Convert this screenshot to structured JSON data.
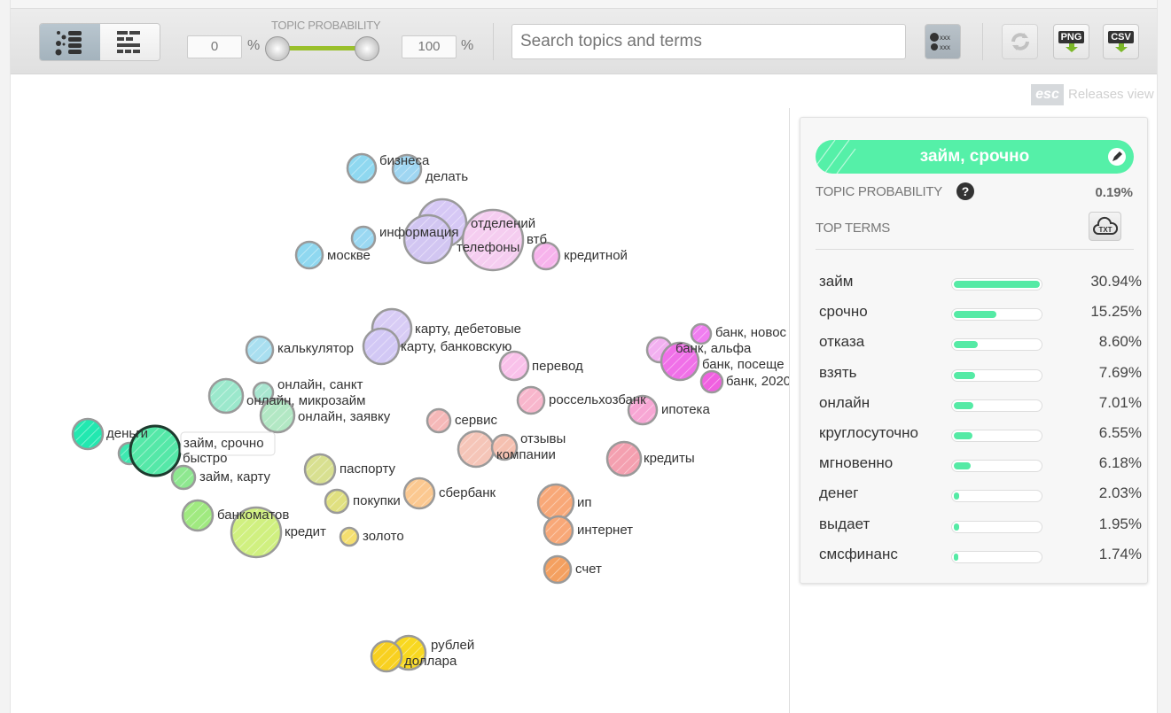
{
  "toolbar": {
    "view_toggle": [
      {
        "name": "bubble-view",
        "active": true
      },
      {
        "name": "list-view",
        "active": false
      }
    ],
    "prob_label": "TOPIC PROBABILITY",
    "min_value": "0",
    "max_value": "100",
    "percent": "%",
    "search_placeholder": "Search topics and terms",
    "buttons": {
      "png": "PNG",
      "csv": "CSV",
      "legend": "xxx"
    },
    "slider_range_percent": [
      0,
      100
    ],
    "slider_color": "#9ac02c"
  },
  "esc": {
    "key": "esc",
    "label": "Releases view"
  },
  "map": {
    "bubbles": [
      {
        "label": "бизнеса",
        "color": "#8fd8f0"
      },
      {
        "label": "делать",
        "color": "#9fd6f2"
      },
      {
        "label": "",
        "color": "#d6c8f5"
      },
      {
        "label": "отделений",
        "color": "#f5cdf0"
      },
      {
        "label": "информация",
        "color": "#d2c6f2"
      },
      {
        "label": "втб",
        "color": ""
      },
      {
        "label": "телефоны",
        "color": ""
      },
      {
        "label": "москве",
        "color": "#8fd8f0"
      },
      {
        "label": "",
        "color": "#9ad8f2"
      },
      {
        "label": "кредитной",
        "color": "#f7b3ec"
      },
      {
        "label": "карту, дебетовые",
        "color": "#d8ccf5"
      },
      {
        "label": "карту, банковскую",
        "color": "#d2c8f5"
      },
      {
        "label": "калькулятор",
        "color": "#a9dff0"
      },
      {
        "label": "перевод",
        "color": "#f9c1ea"
      },
      {
        "label": "россельхозбанк",
        "color": "#f8b6cc"
      },
      {
        "label": "сервис",
        "color": "#f5b8b8"
      },
      {
        "label": "компании",
        "color": "#f5c5b8"
      },
      {
        "label": "отзывы",
        "color": "#f5c0b0"
      },
      {
        "label": "онлайн, санкт",
        "color": "#a8e6d0"
      },
      {
        "label": "",
        "color": "#9be8cc"
      },
      {
        "label": "онлайн, микрозайм",
        "color": ""
      },
      {
        "label": "онлайн, заявку",
        "color": "#b2e8c4"
      },
      {
        "label": "деньги",
        "color": "#22e8b0"
      },
      {
        "label": "",
        "color": "#3ee8b0"
      },
      {
        "label": "займ, срочно",
        "color": "#55e8a8",
        "selected": true
      },
      {
        "label": "быстро",
        "color": ""
      },
      {
        "label": "займ, карту",
        "color": "#8ee890"
      },
      {
        "label": "банкоматов",
        "color": "#a0ea80"
      },
      {
        "label": "кредит",
        "color": "#d0f080"
      },
      {
        "label": "паспорту",
        "color": "#d8e090"
      },
      {
        "label": "покупки",
        "color": "#e0e080"
      },
      {
        "label": "золото",
        "color": "#f5df70"
      },
      {
        "label": "сбербанк",
        "color": "#fbc890"
      },
      {
        "label": "ип",
        "color": "#f8a878"
      },
      {
        "label": "интернет",
        "color": "#f8a878"
      },
      {
        "label": "счет",
        "color": "#f4a060"
      },
      {
        "label": "кредиты",
        "color": "#f4a0b0"
      },
      {
        "label": "ипотека",
        "color": "#f7a6d4"
      },
      {
        "label": "банк, новос",
        "color": "#f07ef0"
      },
      {
        "label": "банк, альфа",
        "color": "#f2b0f0"
      },
      {
        "label": "банк, посеще",
        "color": "#f070e8"
      },
      {
        "label": "банк, 2020",
        "color": "#f060e0"
      },
      {
        "label": "рублей",
        "color": "#f8d820"
      },
      {
        "label": "доллара",
        "color": "#f8d020"
      }
    ]
  },
  "panel": {
    "title": "займ, срочно",
    "title_color": "#55f0a8",
    "prob_label": "TOPIC PROBABILITY",
    "prob_value": "0.19%",
    "top_terms_label": "TOP TERMS",
    "txt_label": "TXT",
    "terms": [
      {
        "term": "займ",
        "value": "30.94%",
        "pct": 30.94
      },
      {
        "term": "срочно",
        "value": "15.25%",
        "pct": 15.25
      },
      {
        "term": "отказа",
        "value": "8.60%",
        "pct": 8.6
      },
      {
        "term": "взять",
        "value": "7.69%",
        "pct": 7.69
      },
      {
        "term": "онлайн",
        "value": "7.01%",
        "pct": 7.01
      },
      {
        "term": "круглосуточно",
        "value": "6.55%",
        "pct": 6.55
      },
      {
        "term": "мгновенно",
        "value": "6.18%",
        "pct": 6.18
      },
      {
        "term": "денег",
        "value": "2.03%",
        "pct": 2.03
      },
      {
        "term": "выдает",
        "value": "1.95%",
        "pct": 1.95
      },
      {
        "term": "смсфинанс",
        "value": "1.74%",
        "pct": 1.74
      }
    ]
  }
}
